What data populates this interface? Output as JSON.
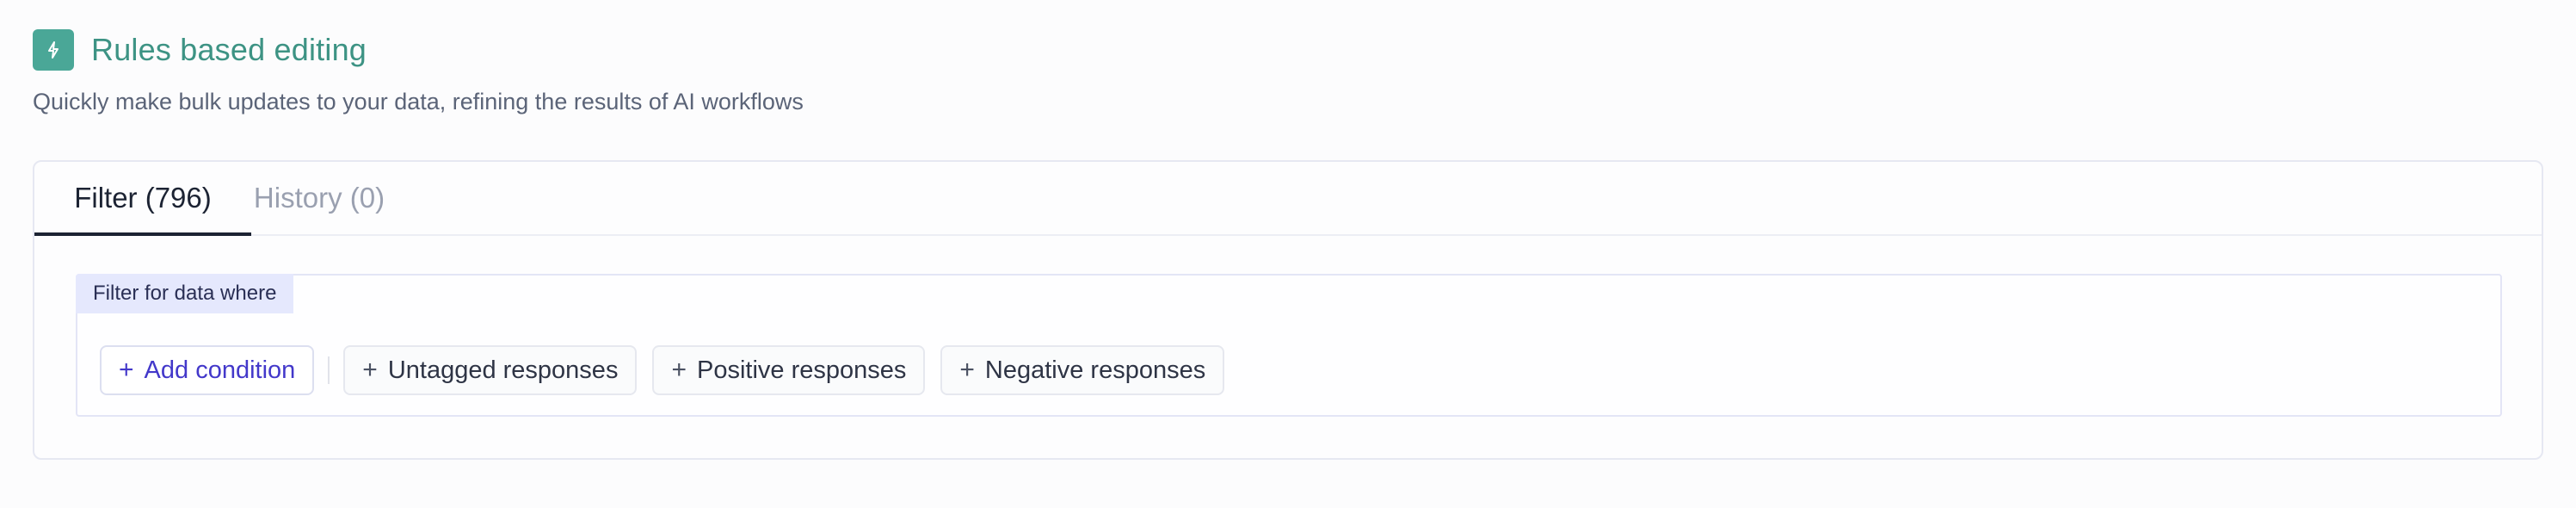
{
  "header": {
    "title": "Rules based editing",
    "subtitle": "Quickly make bulk updates to your data, refining the results of AI workflows",
    "icon": "lightning-icon",
    "accent_color": "#4aa797"
  },
  "tabs": [
    {
      "label": "Filter (796)",
      "active": true
    },
    {
      "label": "History (0)",
      "active": false
    }
  ],
  "filter": {
    "label": "Filter for data where",
    "add_condition": {
      "plus": "+",
      "label": "Add condition",
      "color": "#4338ca"
    },
    "quick_filters": [
      {
        "plus": "+",
        "label": "Untagged responses"
      },
      {
        "plus": "+",
        "label": "Positive responses"
      },
      {
        "plus": "+",
        "label": "Negative responses"
      }
    ]
  }
}
